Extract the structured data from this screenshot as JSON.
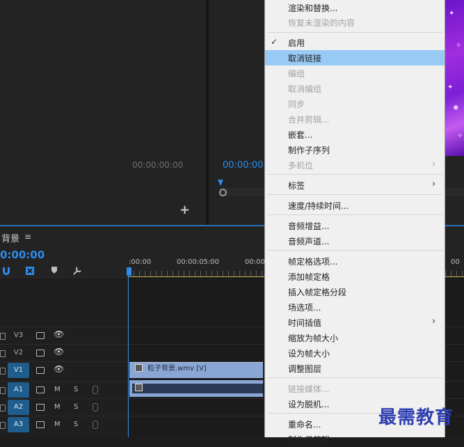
{
  "source_monitor": {
    "timecode": "00:00:00:00",
    "add_label": "+"
  },
  "program_monitor": {
    "timecode": "00:00:00"
  },
  "timeline": {
    "sequence_name": "背景",
    "menu_icon": "≡",
    "timecode": "0:00:00",
    "ruler_labels": [
      ":00:00",
      "00:00:05:00",
      "00:00",
      "00"
    ],
    "tools": [
      "magnet-icon",
      "linked-selection-icon",
      "add-marker-icon",
      "wrench-icon"
    ],
    "tracks": [
      {
        "label": "V3",
        "type": "video",
        "active": false
      },
      {
        "label": "V2",
        "type": "video",
        "active": false
      },
      {
        "label": "V1",
        "type": "video",
        "active": true
      },
      {
        "label": "A1",
        "type": "audio",
        "active": true
      },
      {
        "label": "A2",
        "type": "audio",
        "active": true
      },
      {
        "label": "A3",
        "type": "audio",
        "active": true
      }
    ],
    "audio_buttons": {
      "mute": "M",
      "solo": "S"
    },
    "video_clip_label": "粒子背景.wmv [V]"
  },
  "context_menu": {
    "items": [
      {
        "label": "渲染和替换...",
        "disabled": false
      },
      {
        "label": "恢复未渲染的内容",
        "disabled": true
      },
      {
        "label": "启用",
        "disabled": false,
        "checked": true
      },
      {
        "label": "取消链接",
        "disabled": false,
        "highlighted": true
      },
      {
        "label": "编组",
        "disabled": true
      },
      {
        "label": "取消编组",
        "disabled": true
      },
      {
        "label": "同步",
        "disabled": true
      },
      {
        "label": "合并剪辑...",
        "disabled": true
      },
      {
        "label": "嵌套...",
        "disabled": false
      },
      {
        "label": "制作子序列",
        "disabled": false
      },
      {
        "label": "多机位",
        "disabled": true,
        "submenu": true
      },
      {
        "label": "标签",
        "disabled": false,
        "submenu": true
      },
      {
        "label": "速度/持续时间...",
        "disabled": false
      },
      {
        "label": "音频增益...",
        "disabled": false
      },
      {
        "label": "音频声道...",
        "disabled": false
      },
      {
        "label": "帧定格选项...",
        "disabled": false
      },
      {
        "label": "添加帧定格",
        "disabled": false
      },
      {
        "label": "插入帧定格分段",
        "disabled": false
      },
      {
        "label": "场选项...",
        "disabled": false
      },
      {
        "label": "时间插值",
        "disabled": false,
        "submenu": true
      },
      {
        "label": "缩放为帧大小",
        "disabled": false
      },
      {
        "label": "设为帧大小",
        "disabled": false
      },
      {
        "label": "调整图层",
        "disabled": false
      },
      {
        "label": "链接媒体...",
        "disabled": true
      },
      {
        "label": "设为脱机...",
        "disabled": false
      },
      {
        "label": "重命名...",
        "disabled": false
      },
      {
        "label": "制作子剪辑",
        "disabled": false
      }
    ],
    "check_glyph": "✓",
    "arrow_glyph": "›"
  },
  "watermark": "最需教育"
}
